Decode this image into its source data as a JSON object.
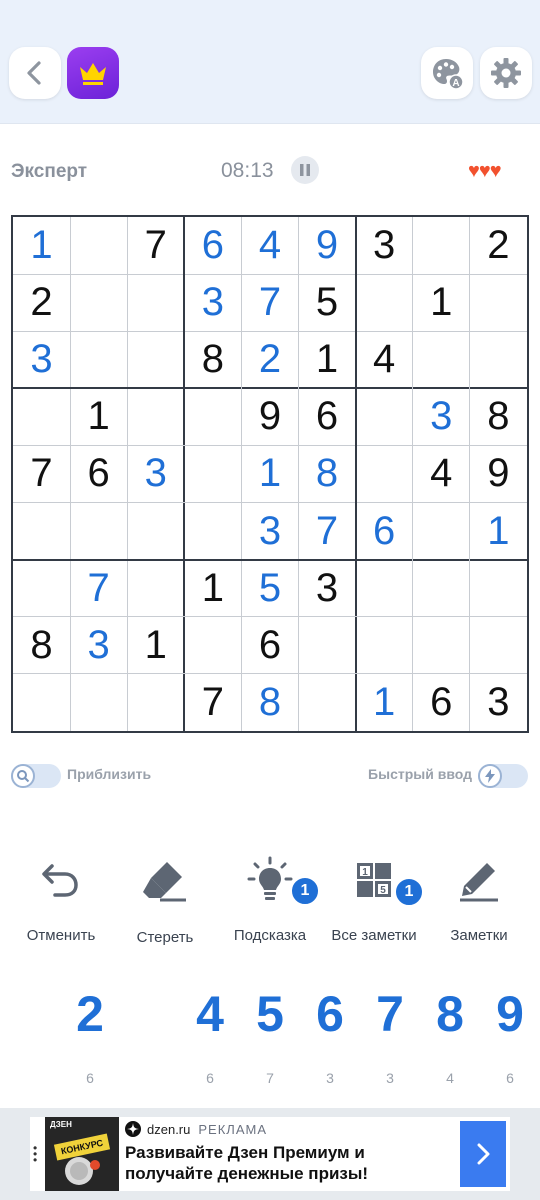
{
  "header": {
    "back_icon": "chevron-left-icon",
    "premium_icon": "crown-icon",
    "theme_icon": "palette-icon",
    "settings_icon": "gear-icon"
  },
  "status": {
    "difficulty": "Эксперт",
    "timer": "08:13",
    "lives": 3
  },
  "board": {
    "rows": [
      [
        "1",
        "",
        "7",
        "6",
        "4",
        "9",
        "3",
        "",
        "2"
      ],
      [
        "2",
        "",
        "",
        "3",
        "7",
        "5",
        "",
        "1",
        ""
      ],
      [
        "3",
        "",
        "",
        "8",
        "2",
        "1",
        "4",
        "",
        ""
      ],
      [
        "",
        "1",
        "",
        "",
        "9",
        "6",
        "",
        "3",
        "8"
      ],
      [
        "7",
        "6",
        "3",
        "",
        "1",
        "8",
        "",
        "4",
        "9"
      ],
      [
        "",
        "",
        "",
        "",
        "3",
        "7",
        "6",
        "",
        "1"
      ],
      [
        "",
        "7",
        "",
        "1",
        "5",
        "3",
        "",
        "",
        ""
      ],
      [
        "8",
        "3",
        "1",
        "",
        "6",
        "",
        "",
        "",
        ""
      ],
      [
        "",
        "",
        "",
        "7",
        "8",
        "",
        "1",
        "6",
        "3"
      ]
    ],
    "user_entered": [
      [
        0,
        0
      ],
      [
        0,
        3
      ],
      [
        0,
        4
      ],
      [
        0,
        5
      ],
      [
        1,
        3
      ],
      [
        1,
        4
      ],
      [
        2,
        0
      ],
      [
        2,
        4
      ],
      [
        3,
        7
      ],
      [
        4,
        2
      ],
      [
        4,
        4
      ],
      [
        4,
        5
      ],
      [
        5,
        4
      ],
      [
        5,
        5
      ],
      [
        5,
        6
      ],
      [
        5,
        8
      ],
      [
        6,
        1
      ],
      [
        6,
        4
      ],
      [
        7,
        1
      ],
      [
        8,
        4
      ],
      [
        8,
        6
      ]
    ]
  },
  "toggles": {
    "zoom_label": "Приблизить",
    "quick_input_label": "Быстрый ввод"
  },
  "tools": [
    {
      "name": "undo",
      "label": "Отменить",
      "icon": "undo-icon"
    },
    {
      "name": "erase",
      "label": "Стереть",
      "icon": "eraser-icon"
    },
    {
      "name": "hint",
      "label": "Подсказка",
      "icon": "lightbulb-icon",
      "badge": "1"
    },
    {
      "name": "all-notes",
      "label": "Все заметки",
      "icon": "notes-grid-icon",
      "badge": "1"
    },
    {
      "name": "notes",
      "label": "Заметки",
      "icon": "pencil-icon"
    }
  ],
  "numpad": [
    {
      "digit": "2",
      "count": "6"
    },
    {
      "digit": "4",
      "count": "6"
    },
    {
      "digit": "5",
      "count": "7"
    },
    {
      "digit": "6",
      "count": "3"
    },
    {
      "digit": "7",
      "count": "3"
    },
    {
      "digit": "8",
      "count": "4"
    },
    {
      "digit": "9",
      "count": "6"
    }
  ],
  "ad": {
    "domain": "dzen.ru",
    "tag": "РЕКЛАМА",
    "title": "Развивайте Дзен Премиум и получайте денежные призы!",
    "thumb_brand": "ДЗЕН",
    "thumb_caption": "КОНКУРС"
  },
  "colors": {
    "accent": "#1f6fd6",
    "hearts": "#f2512e",
    "premium": "#7a2fe0"
  }
}
